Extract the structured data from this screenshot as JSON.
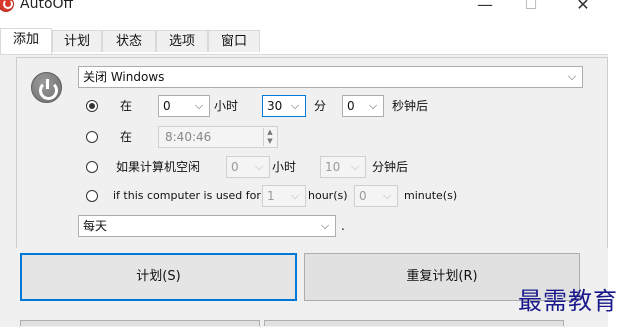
{
  "app": {
    "title": "AutoOff",
    "window_buttons": {
      "minimize": "—",
      "maximize": "☐",
      "close": "✕"
    }
  },
  "tabs": [
    {
      "label": "添加",
      "active": true
    },
    {
      "label": "计划"
    },
    {
      "label": "状态"
    },
    {
      "label": "选项"
    },
    {
      "label": "窗口"
    }
  ],
  "action": {
    "selected": "关闭 Windows"
  },
  "options": {
    "row1": {
      "prefix": "在",
      "hours_value": "0",
      "hours_unit": "小时",
      "minutes_value": "30",
      "minutes_unit": "分",
      "seconds_value": "0",
      "seconds_unit": "秒钟后",
      "checked": true
    },
    "row2": {
      "prefix": "在",
      "time_value": "8:40:46",
      "checked": false
    },
    "row3": {
      "prefix": "如果计算机空闲",
      "hours_value": "0",
      "hours_unit": "小时",
      "minutes_value": "10",
      "minutes_unit": "分钟后",
      "checked": false
    },
    "row4": {
      "prefix": "if this computer is used for",
      "hours_value": "1",
      "hours_unit": "hour(s)",
      "minutes_value": "0",
      "minutes_unit": "minute(s)",
      "checked": false
    }
  },
  "repeat": {
    "selected": "每天",
    "suffix": "."
  },
  "buttons": {
    "schedule": "计划(S)",
    "repeat_schedule": "重复计划(R)"
  },
  "watermark": "最需教育",
  "colors": {
    "accent": "#0078d7",
    "icon_red": "#d63a2a",
    "watermark": "#1a1a8c"
  }
}
